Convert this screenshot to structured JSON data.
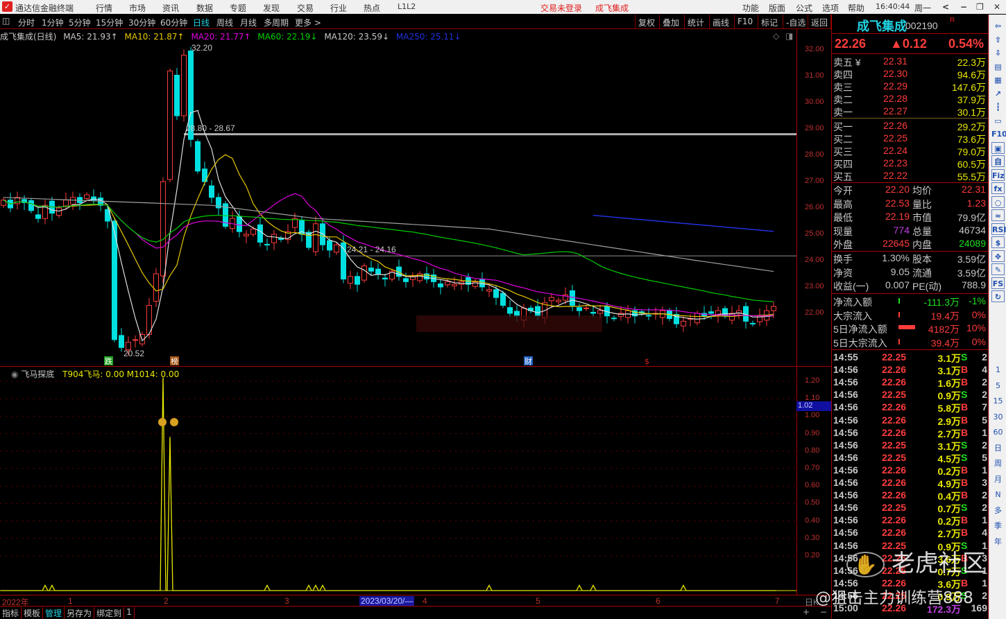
{
  "titlebar": {
    "app": "通达信金融终端",
    "menus": [
      "行情",
      "市场",
      "资讯",
      "数据",
      "专题",
      "发现",
      "交易",
      "行业",
      "热点",
      "L1L2"
    ],
    "login_status": "交易未登录",
    "stock": "成飞集成",
    "right_menus": [
      "功能",
      "版面",
      "公式",
      "选项",
      "帮助"
    ],
    "time": "16:40:44",
    "weekday": "周一"
  },
  "toolbar": {
    "periods": [
      "分时",
      "1分钟",
      "5分钟",
      "15分钟",
      "30分钟",
      "60分钟",
      "日线",
      "周线",
      "月线",
      "多周期",
      "更多 >"
    ],
    "active": "日线",
    "actions": [
      "复权",
      "叠加",
      "统计",
      "画线",
      "F10",
      "标记",
      "-自选",
      "返回"
    ]
  },
  "legend": {
    "name": "成飞集成(日线)",
    "ma5": "MA5: 21.93↑",
    "ma10": "MA10: 21.87↑",
    "ma20": "MA20: 21.77↑",
    "ma60": "MA60: 22.19↓",
    "ma120": "MA120: 23.59↓",
    "ma250": "MA250: 25.11↓"
  },
  "colors": {
    "up": "#ff3c3c",
    "down": "#00e0e0",
    "ma5": "#e0e0e0",
    "ma10": "#e8c800",
    "ma20": "#e000e0",
    "ma60": "#00d000",
    "ma120": "#a0a0a0",
    "ma250": "#2030e0",
    "indicator": "#e8e800"
  },
  "chart_data": {
    "type": "candlestick",
    "ylim": [
      20.3,
      32.4
    ],
    "yticks": [
      "32.00",
      "31.00",
      "30.00",
      "29.00",
      "28.00",
      "27.00",
      "26.00",
      "25.00",
      "24.00",
      "23.00",
      "22.00"
    ],
    "closes": [
      26.3,
      26.0,
      26.4,
      26.2,
      25.9,
      25.6,
      26.1,
      25.8,
      26.0,
      26.3,
      26.4,
      26.2,
      26.5,
      26.3,
      26.1,
      25.5,
      21.0,
      20.7,
      20.9,
      21.0,
      21.2,
      22.3,
      23.5,
      27.0,
      31.2,
      29.5,
      31.8,
      28.6,
      27.4,
      27.0,
      26.4,
      26.0,
      25.3,
      25.6,
      25.1,
      25.0,
      25.2,
      24.7,
      24.6,
      25.0,
      24.8,
      25.1,
      25.6,
      25.0,
      24.5,
      25.4,
      24.6,
      24.4,
      24.6,
      23.3,
      23.4,
      23.1,
      23.8,
      23.6,
      23.5,
      23.3,
      23.6,
      23.4,
      23.2,
      23.4,
      23.5,
      23.3,
      23.2,
      23.0,
      23.2,
      23.1,
      23.2,
      23.1,
      23.2,
      23.0,
      22.9,
      22.6,
      22.3,
      22.0,
      21.9,
      22.2,
      22.1,
      21.9,
      22.4,
      22.6,
      22.5,
      22.7,
      22.3,
      22.1,
      22.2,
      22.0,
      22.1,
      21.9,
      21.8,
      22.0,
      22.1,
      21.9,
      22.0,
      21.9,
      22.0,
      22.1,
      21.8,
      21.6,
      21.7,
      21.8,
      22.0,
      21.9,
      22.0,
      22.1,
      21.9,
      22.0,
      22.1,
      21.7,
      21.6,
      21.9,
      22.1,
      22.26
    ],
    "ma120_points": [
      [
        0,
        26.4
      ],
      [
        30,
        26.1
      ],
      [
        45,
        25.6
      ],
      [
        70,
        25.2
      ],
      [
        100,
        24.0
      ],
      [
        111,
        23.59
      ]
    ],
    "ma250_points": [
      [
        85,
        25.72
      ],
      [
        111,
        25.11
      ]
    ],
    "annotations": {
      "high": "32.20",
      "resist": "28.80 - 28.67",
      "support": "24.21 - 24.16",
      "low": "20.52"
    },
    "lines": {
      "resist": 28.8,
      "support": 24.18
    },
    "markers": [
      {
        "text": "跌",
        "color": "#20a020"
      },
      {
        "text": "榜",
        "color": "#a05010"
      },
      {
        "text": "财",
        "color": "#2060c0"
      },
      {
        "text": "$",
        "color": "#e02020"
      }
    ],
    "indicator": {
      "name": "飞马探底",
      "values_label": "T904飞马: 0.00  M1014: 0.00",
      "ylim": [
        0,
        1.25
      ],
      "yticks": [
        "1.20",
        "1.10",
        "1.00",
        "0.90",
        "0.80",
        "0.70",
        "0.60",
        "0.50",
        "0.40",
        "0.30",
        "0.20"
      ],
      "current": "1.02",
      "spikes": [
        [
          23,
          1.22
        ],
        [
          24,
          0.88
        ]
      ],
      "bumps": [
        6,
        7,
        24,
        38,
        44,
        45,
        46,
        70,
        83,
        85,
        98
      ]
    },
    "xlabels": [
      "2022年",
      "1",
      "2",
      "3",
      "2023/03/20/—",
      "4",
      "5",
      "6",
      "7"
    ]
  },
  "quote": {
    "name": "成飞集成",
    "code": "002190",
    "flag": "R",
    "price": "22.26",
    "change": "▲0.12",
    "pct": "0.54%",
    "sells": [
      [
        "卖五 ¥",
        "22.31",
        "22.3万"
      ],
      [
        "卖四",
        "22.30",
        "94.6万"
      ],
      [
        "卖三",
        "22.29",
        "147.6万"
      ],
      [
        "卖二",
        "22.28",
        "37.9万"
      ],
      [
        "卖一",
        "22.27",
        "30.1万"
      ]
    ],
    "buys": [
      [
        "买一",
        "22.26",
        "29.2万"
      ],
      [
        "买二",
        "22.25",
        "73.6万"
      ],
      [
        "买三",
        "22.24",
        "79.0万"
      ],
      [
        "买四",
        "22.23",
        "60.5万"
      ],
      [
        "买五",
        "22.22",
        "55.5万"
      ]
    ],
    "stats": [
      [
        "今开",
        "22.20",
        "均价",
        "22.31"
      ],
      [
        "最高",
        "22.53",
        "量比",
        "1.23"
      ],
      [
        "最低",
        "22.19",
        "市值",
        "79.9亿"
      ],
      [
        "现量",
        "774",
        "总量",
        "46734"
      ],
      [
        "外盘",
        "22645",
        "内盘",
        "24089"
      ]
    ],
    "fund": [
      [
        "换手",
        "1.30%",
        "股本",
        "3.59亿"
      ],
      [
        "净资",
        "9.05",
        "流通",
        "3.59亿"
      ],
      [
        "收益(一)",
        "0.007",
        "PE(动)",
        "788.9"
      ]
    ],
    "flows": [
      [
        "净流入额",
        "-111.3万",
        "-1%"
      ],
      [
        "大宗流入",
        "19.4万",
        "0%"
      ],
      [
        "5日净流入额",
        "4182万",
        "10%"
      ],
      [
        "5日大宗流入",
        "39.4万",
        "0%"
      ]
    ],
    "ticks": [
      [
        "14:55",
        "22.25",
        "3.1万",
        "S",
        "2"
      ],
      [
        "14:56",
        "22.26",
        "3.1万",
        "B",
        "4"
      ],
      [
        "14:56",
        "22.26",
        "1.6万",
        "B",
        "2"
      ],
      [
        "14:56",
        "22.25",
        "0.9万",
        "S",
        "2"
      ],
      [
        "14:56",
        "22.26",
        "5.8万",
        "B",
        "7"
      ],
      [
        "14:56",
        "22.26",
        "2.9万",
        "B",
        "5"
      ],
      [
        "14:56",
        "22.26",
        "2.7万",
        "B",
        "1"
      ],
      [
        "14:56",
        "22.25",
        "3.1万",
        "S",
        "2"
      ],
      [
        "14:56",
        "22.25",
        "4.5万",
        "S",
        "5"
      ],
      [
        "14:56",
        "22.26",
        "0.2万",
        "B",
        "1"
      ],
      [
        "14:56",
        "22.26",
        "4.9万",
        "B",
        "3"
      ],
      [
        "14:56",
        "22.26",
        "0.4万",
        "B",
        "2"
      ],
      [
        "14:56",
        "22.25",
        "0.7万",
        "S",
        "2"
      ],
      [
        "14:56",
        "22.26",
        "0.2万",
        "B",
        "1"
      ],
      [
        "14:56",
        "22.26",
        "2.7万",
        "B",
        "4"
      ],
      [
        "14:56",
        "22.25",
        "0.9万",
        "S",
        "1"
      ],
      [
        "14:56",
        "22.26",
        "3.6万",
        "B",
        "3"
      ],
      [
        "14:56",
        "22.25",
        "0.7万",
        "S",
        "1"
      ],
      [
        "14:56",
        "22.26",
        "3.6万",
        "B",
        "1"
      ],
      [
        "14:56",
        "22.25",
        "0.9万",
        "S",
        "2"
      ],
      [
        "15:00",
        "22.26",
        "172.3万",
        "",
        "169"
      ]
    ]
  },
  "iconbar": {
    "icons": [
      "⇦",
      "⇧",
      "⇩",
      "▤",
      "▦",
      "↗",
      "┇",
      "▭",
      "F10",
      "▣",
      "自",
      "Fiz",
      "fx",
      "○",
      "≈",
      "RSI",
      "$",
      "✥",
      "✎",
      "FS",
      "↻"
    ],
    "periods": [
      "1",
      "5",
      "15",
      "30",
      "60",
      "日",
      "周",
      "月",
      "N",
      "多",
      "季",
      "年"
    ]
  },
  "axis_bottom": {
    "label": "日K",
    "plus": "+",
    "minus": "−"
  },
  "bottom_tabs": [
    "指标",
    "模板",
    "管理",
    "另存为",
    "绑定到",
    "1"
  ],
  "bottom_active": "管理",
  "watermarks": {
    "community": "老虎社区",
    "author": "@狙击主力训练营888"
  }
}
